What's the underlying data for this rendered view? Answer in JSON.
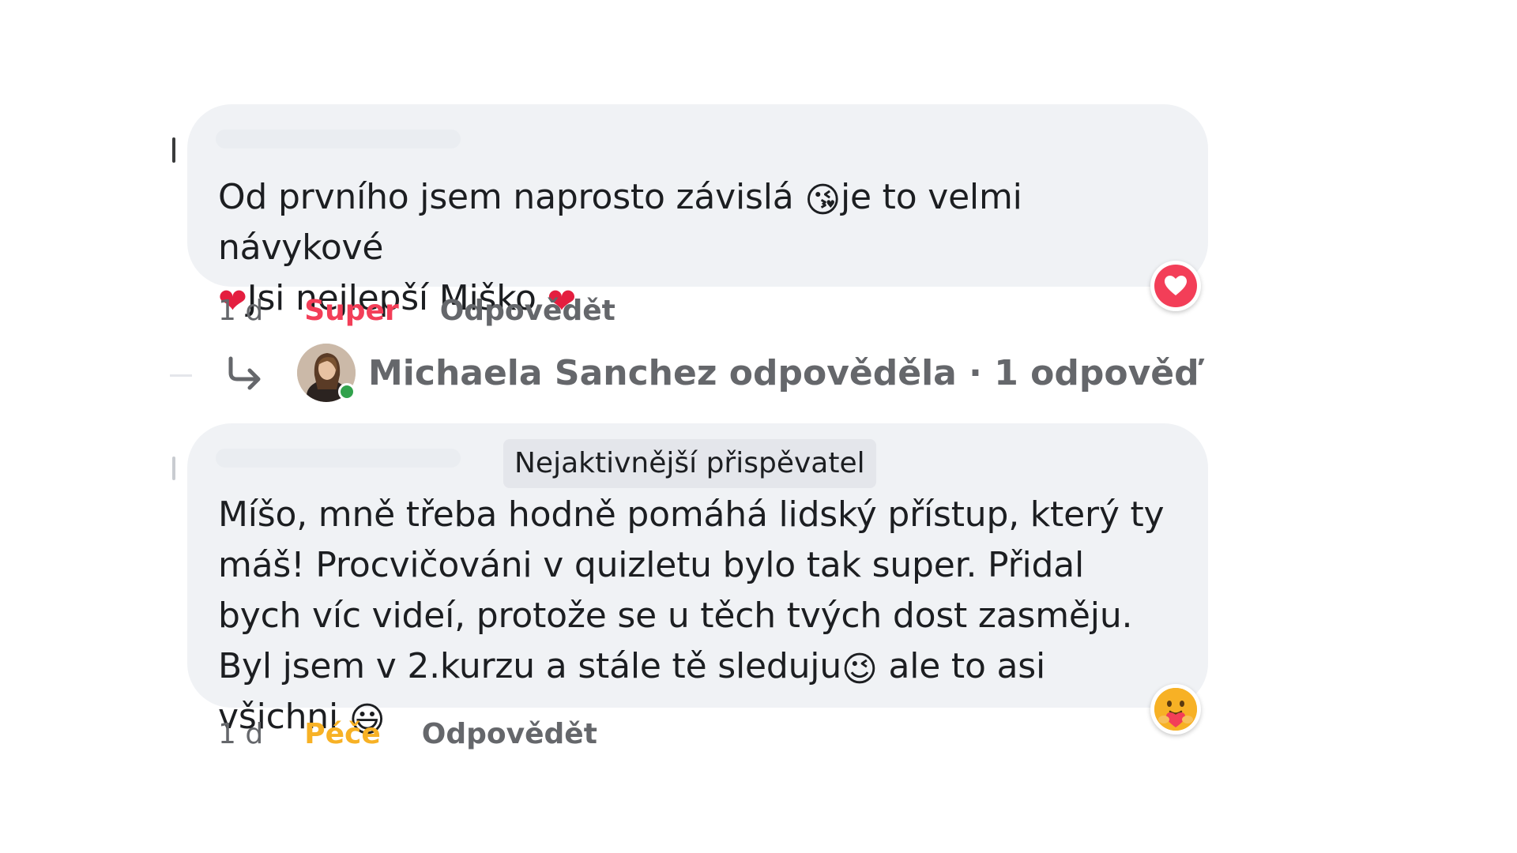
{
  "comments": [
    {
      "text_part1": "Od prvního jsem naprosto závislá ",
      "emoji1": "😘",
      "text_part2": "je to velmi návykové",
      "heart1": "❤",
      "text_part3": "Jsi nejlepší Miško ",
      "heart2": "❤",
      "time": "1 d",
      "reaction_label": "Super",
      "reply_label": "Odpovědět",
      "reaction_icon": "heart-reaction-icon",
      "reaction_color": "#f33e58"
    },
    {
      "badge": "Nejaktivnější přispěvatel",
      "text_part1": "Míšo, mně třeba hodně pomáhá lidský přístup, který ty máš! Procvičováni v quizletu bylo tak super. Přidal bych víc videí, protože se u těch tvých dost zasměju. Byl jsem v 2.kurzu a stále tě sleduju",
      "emoji1": "😉",
      "text_part2": " ale to asi všichni ",
      "emoji2": "😃",
      "time": "1 d",
      "reaction_label": "Péče",
      "reply_label": "Odpovědět",
      "reaction_icon": "care-reaction-icon",
      "reaction_color": "#f7b125"
    }
  ],
  "replies": {
    "text": "Michaela Sanchez odpověděla · 1 odpověď",
    "icon": "reply-arrow-icon"
  },
  "colors": {
    "bubble_bg": "#f0f2f5",
    "meta_text": "#65676b",
    "online": "#31a24c"
  }
}
